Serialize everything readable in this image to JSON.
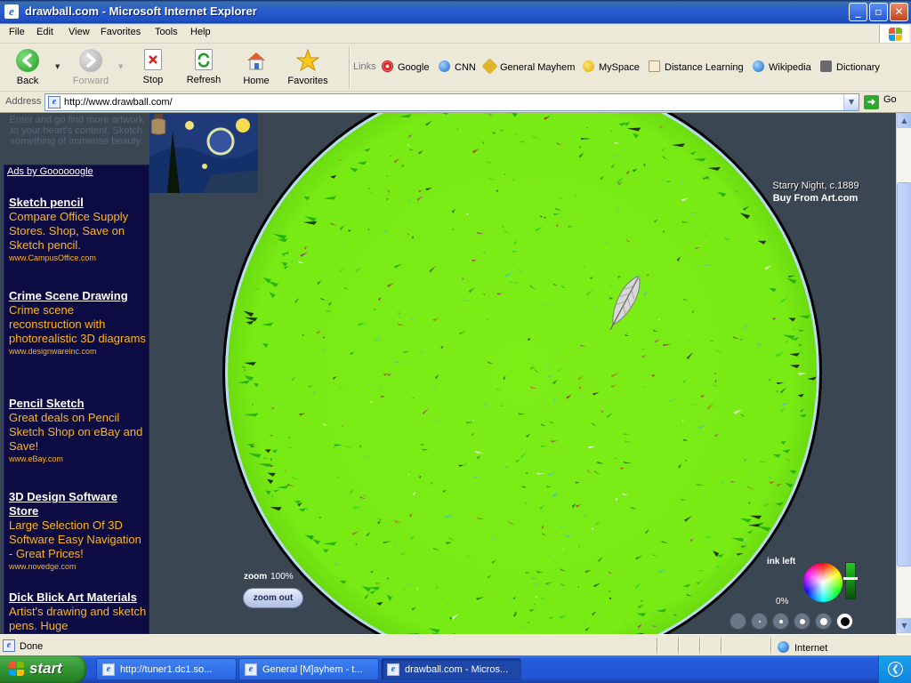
{
  "window": {
    "title": "drawball.com - Microsoft Internet Explorer",
    "icon": "ie-icon",
    "controls": [
      "minimize",
      "maximize",
      "close"
    ]
  },
  "menu": [
    "File",
    "Edit",
    "View",
    "Favorites",
    "Tools",
    "Help"
  ],
  "toolbar": {
    "back": "Back",
    "forward": "Forward",
    "stop": "Stop",
    "refresh": "Refresh",
    "home": "Home",
    "favorites": "Favorites"
  },
  "links": {
    "label": "Links",
    "items": [
      "Google",
      "CNN",
      "General Mayhem",
      "MySpace",
      "Distance Learning",
      "Wikipedia",
      "Dictionary"
    ]
  },
  "address": {
    "label": "Address",
    "url": "http://www.drawball.com/",
    "go": "Go"
  },
  "page": {
    "blurb": "Enter and go find more artwork to your heart's content. Sketch something of immense beauty.",
    "ads_header": "Ads by Goooooogle",
    "ads": [
      {
        "title": "Sketch pencil",
        "body": "Compare Office Supply Stores. Shop, Save on Sketch pencil.",
        "url": "www.CampusOffice.com"
      },
      {
        "title": "Crime Scene Drawing",
        "body": "Crime scene reconstruction with photorealistic 3D diagrams",
        "url": "www.designwareinc.com"
      },
      {
        "title": "Pencil Sketch",
        "body": "Great deals on Pencil Sketch Shop on eBay and Save!",
        "url": "www.eBay.com"
      },
      {
        "title": "3D Design Software Store",
        "body": "Large Selection Of 3D Software Easy Navigation - Great Prices!",
        "url": "www.novedge.com"
      },
      {
        "title": "Dick Blick Art Materials",
        "body": "Artist's drawing and sketch pens. Huge",
        "url": ""
      }
    ],
    "art": {
      "caption": "Starry Night, c.1889",
      "buy": "Buy From Art.com"
    },
    "zoom": {
      "label": "zoom",
      "value": "100%",
      "button": "zoom out"
    },
    "ink": {
      "label": "ink left",
      "value": "0%"
    },
    "ball_color": "#7ded16",
    "background_color": "#3b4653"
  },
  "status": {
    "text": "Done",
    "zone": "Internet"
  },
  "taskbar": {
    "start": "start",
    "tasks": [
      {
        "label": "http://tuner1.dc1.so...",
        "active": false
      },
      {
        "label": "General [M]ayhem - t...",
        "active": false
      },
      {
        "label": "drawball.com - Micros...",
        "active": true
      }
    ]
  }
}
